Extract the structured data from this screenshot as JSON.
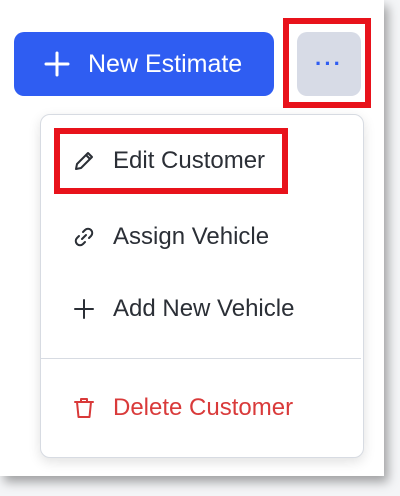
{
  "toolbar": {
    "new_estimate_label": "New Estimate",
    "more_label": "···"
  },
  "menu": {
    "items": [
      {
        "label": "Edit Customer",
        "icon": "pencil-icon"
      },
      {
        "label": "Assign Vehicle",
        "icon": "link-icon"
      },
      {
        "label": "Add New Vehicle",
        "icon": "plus-icon"
      },
      {
        "label": "Delete Customer",
        "icon": "trash-icon"
      }
    ]
  },
  "colors": {
    "primary": "#2f5df2",
    "highlight": "#e8121b",
    "danger": "#d93a3a",
    "more_button_bg": "#d7dbe6"
  }
}
